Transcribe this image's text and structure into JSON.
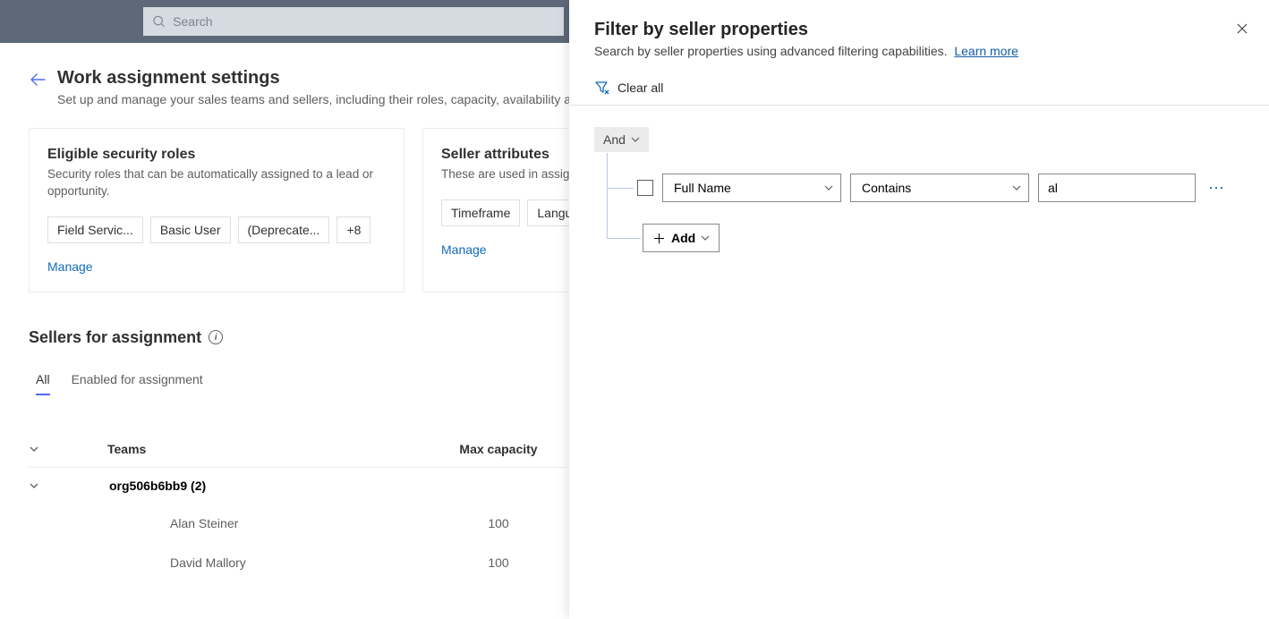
{
  "topbar": {
    "search_placeholder": "Search"
  },
  "page": {
    "title": "Work assignment settings",
    "subtitle": "Set up and manage your sales teams and sellers, including their roles, capacity, availability and work assignment."
  },
  "cards": {
    "roles": {
      "title": "Eligible security roles",
      "desc": "Security roles that can be automatically assigned to a lead or opportunity.",
      "chips": [
        "Field Servic...",
        "Basic User",
        "(Deprecate...",
        "+8"
      ],
      "manage": "Manage"
    },
    "attrs": {
      "title": "Seller attributes",
      "desc": "These are used in assignment rules.",
      "chips": [
        "Timeframe",
        "Language"
      ],
      "manage": "Manage"
    }
  },
  "sellers": {
    "heading": "Sellers for assignment",
    "tabs": {
      "all": "All",
      "enabled": "Enabled for assignment"
    },
    "columns": {
      "teams": "Teams",
      "max": "Max capacity"
    },
    "group": "org506b6bb9 (2)",
    "rows": [
      {
        "name": "Alan Steiner",
        "cap": "100"
      },
      {
        "name": "David Mallory",
        "cap": "100"
      }
    ]
  },
  "panel": {
    "title": "Filter by seller properties",
    "subtitle": "Search by seller properties using advanced filtering capabilities.",
    "learn": "Learn more",
    "clear": "Clear all",
    "and": "And",
    "rule": {
      "field": "Full Name",
      "operator": "Contains",
      "value": "al"
    },
    "add": "Add"
  }
}
